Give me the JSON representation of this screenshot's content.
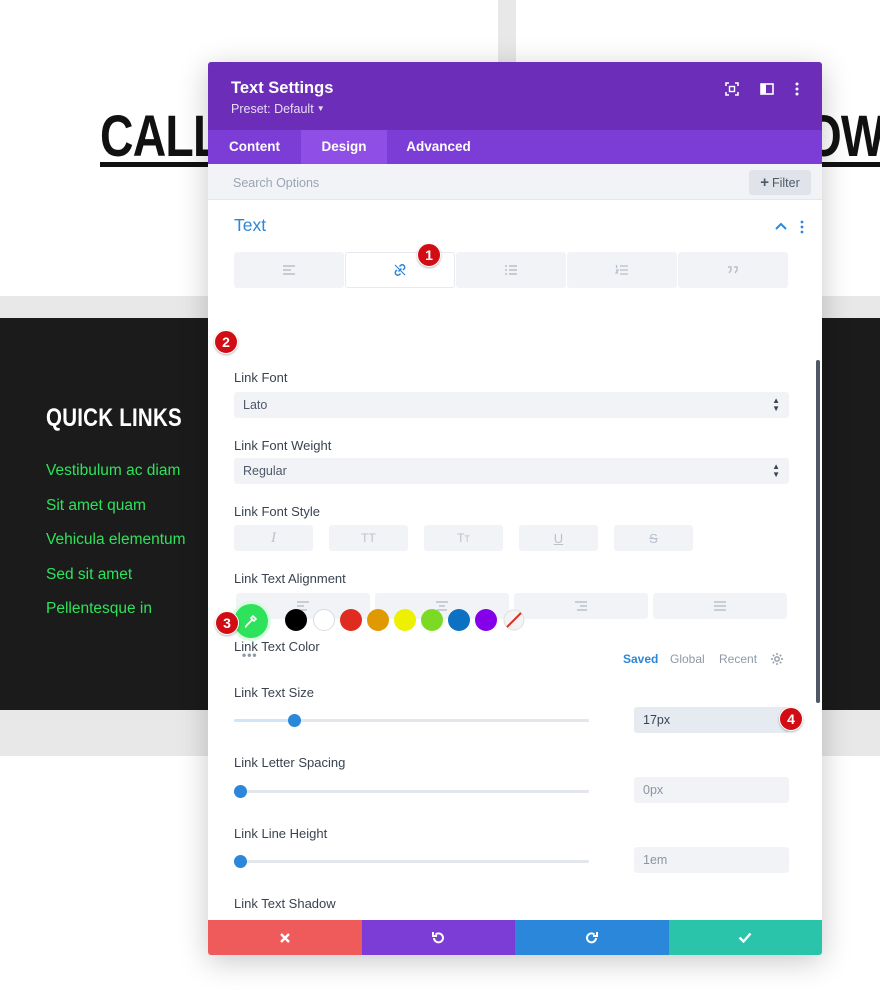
{
  "background": {
    "heading_left": "CALL",
    "heading_right": "OW",
    "quick_links": {
      "title": "QUICK LINKS",
      "items": [
        "Vestibulum ac diam",
        "Sit amet quam",
        "Vehicula elementum",
        "Sed sit amet",
        "Pellentesque in"
      ],
      "link_color": "#2ee25b"
    }
  },
  "modal": {
    "title": "Text Settings",
    "preset": "Preset: Default",
    "tabs": [
      "Content",
      "Design",
      "Advanced"
    ],
    "active_tab": "Design",
    "search_placeholder": "Search Options",
    "filter_label": "Filter",
    "section_title": "Text",
    "text_subtabs": [
      "paragraph-align-icon",
      "link-icon",
      "unordered-list-icon",
      "ordered-list-icon",
      "quote-icon"
    ],
    "active_subtab": 1,
    "fields": {
      "link_font": {
        "label": "Link Font",
        "value": "Lato"
      },
      "link_font_weight": {
        "label": "Link Font Weight",
        "value": "Regular"
      },
      "link_font_style": {
        "label": "Link Font Style",
        "buttons": [
          "italic-icon",
          "uppercase-icon",
          "capitalize-icon",
          "underline-icon",
          "strikethrough-icon"
        ]
      },
      "link_text_alignment": {
        "label": "Link Text Alignment",
        "buttons": [
          "align-left-icon",
          "align-center-icon",
          "align-right-icon",
          "align-justify-icon"
        ]
      },
      "link_text_color": {
        "label": "Link Text Color",
        "selected_color": "#2ee25b",
        "swatches": [
          "#000000",
          "#ffffff",
          "#e02b20",
          "#e09900",
          "#edf000",
          "#7cda24",
          "#0c71c3",
          "#8300e9"
        ],
        "palette_tabs": [
          "Saved",
          "Global",
          "Recent"
        ],
        "active_palette_tab": "Saved"
      },
      "link_text_size": {
        "label": "Link Text Size",
        "value": "17px",
        "slider_fraction": 0.17
      },
      "link_letter_spacing": {
        "label": "Link Letter Spacing",
        "value": "0px",
        "slider_fraction": 0
      },
      "link_line_height": {
        "label": "Link Line Height",
        "value": "1em",
        "slider_fraction": 0
      },
      "link_text_shadow": {
        "label": "Link Text Shadow"
      }
    },
    "footer_buttons": [
      "close-icon",
      "undo-icon",
      "redo-icon",
      "check-icon"
    ]
  },
  "annotations": [
    "1",
    "2",
    "3",
    "4"
  ],
  "colors": {
    "header": "#6c2eb9",
    "tabs": "#7c3cd6",
    "accent": "#2b87da",
    "badge": "#d20c15"
  }
}
